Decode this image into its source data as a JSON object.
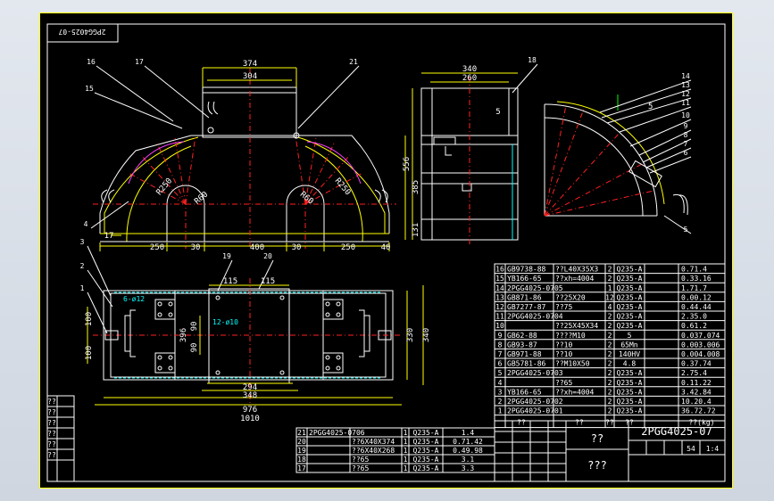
{
  "sheet": {
    "drawing_no": "2PGG4025-07",
    "corner_code": "2PGG4025-07",
    "title": "??",
    "subtitle": "???",
    "scale_row": [
      "54",
      "1:4"
    ]
  },
  "views": {
    "front_dims": [
      "374",
      "304",
      "250",
      "30",
      "400",
      "30",
      "250",
      "40",
      "17",
      "R250",
      "R250",
      "R60",
      "R60",
      "556",
      "385",
      "131"
    ],
    "side_dims": [
      "340",
      "260",
      "5"
    ],
    "detail_dims": [
      "5"
    ],
    "plan_dims": [
      "115",
      "115",
      "6-ø12",
      "12-ø10",
      "100",
      "100",
      "396",
      "330",
      "340",
      "90",
      "90",
      "294",
      "348",
      "976",
      "1010"
    ],
    "balloons": [
      "16",
      "17",
      "15",
      "21",
      "4",
      "18",
      "14",
      "13",
      "12",
      "11",
      "10",
      "9",
      "8",
      "7",
      "6",
      "5",
      "3",
      "2",
      "1",
      "19",
      "20"
    ]
  },
  "parts_list": {
    "rows": [
      [
        "16",
        "GB9738-88",
        "??L40X35X3",
        "2",
        "Q235-A",
        "0.71.4"
      ],
      [
        "15",
        "YB166-65",
        "??xh=4004",
        "2",
        "Q235-A",
        "0.33.16"
      ],
      [
        "14",
        "2PGG4025-0705",
        "",
        "1",
        "Q235-A",
        "1.71.7"
      ],
      [
        "13",
        "GB871-86",
        "??25X20",
        "12",
        "Q235-A",
        "0.00.12"
      ],
      [
        "12",
        "GB7277-87",
        "??75",
        "4",
        "Q235-A",
        "0.44.44"
      ],
      [
        "11",
        "2PGG4025-0704",
        "",
        "2",
        "Q235-A",
        "2.35.0"
      ],
      [
        "10",
        "",
        "??25X45X34",
        "2",
        "Q235-A",
        "0.61.2"
      ],
      [
        "9",
        "GB62-88",
        "????M10",
        "2",
        "5",
        "0.037.074"
      ],
      [
        "8",
        "GB93-87",
        "??10",
        "2",
        "65Mn",
        "0.003.006"
      ],
      [
        "7",
        "GB971-88",
        "??10",
        "2",
        "140HV",
        "0.004.008"
      ],
      [
        "6",
        "GB5781-86",
        "??M10X50",
        "2",
        "4.8",
        "0.37.74"
      ],
      [
        "5",
        "2PGG4025-0703",
        "",
        "2",
        "Q235-A",
        "2.75.4"
      ],
      [
        "4",
        "",
        "??65",
        "2",
        "Q235-A",
        "0.11.22"
      ],
      [
        "3",
        "YB166-65",
        "??xh=4004",
        "2",
        "Q235-A",
        "3.42.84"
      ],
      [
        "2",
        "2PGG4025-0702",
        "",
        "2",
        "Q235-A",
        "10.20.4"
      ],
      [
        "1",
        "2PGG4025-0701",
        "",
        "2",
        "Q235-A",
        "36.72.72"
      ]
    ],
    "header": [
      "??",
      "??",
      "??",
      "??",
      "??(kg)"
    ]
  },
  "lower_list": {
    "rows": [
      [
        "21",
        "2PGG4025-0706",
        "",
        "1",
        "Q235-A",
        "1.4"
      ],
      [
        "20",
        "",
        "??6X40X374",
        "1",
        "Q235-A",
        "0.71.42"
      ],
      [
        "19",
        "",
        "??6X40X268",
        "1",
        "Q235-A",
        "0.49.98"
      ],
      [
        "18",
        "",
        "??65",
        "1",
        "Q235-A",
        "3.1"
      ],
      [
        "17",
        "",
        "??65",
        "1",
        "Q235-A",
        "3.3"
      ]
    ]
  },
  "left_stamps": [
    "??",
    "??",
    "??",
    "??",
    "??",
    "??"
  ],
  "colors": {
    "yellow": "#ffff00",
    "white": "#ffffff",
    "cyan": "#00ffff",
    "red": "#ff2020",
    "magenta": "#ff40ff",
    "green": "#00ff00"
  }
}
